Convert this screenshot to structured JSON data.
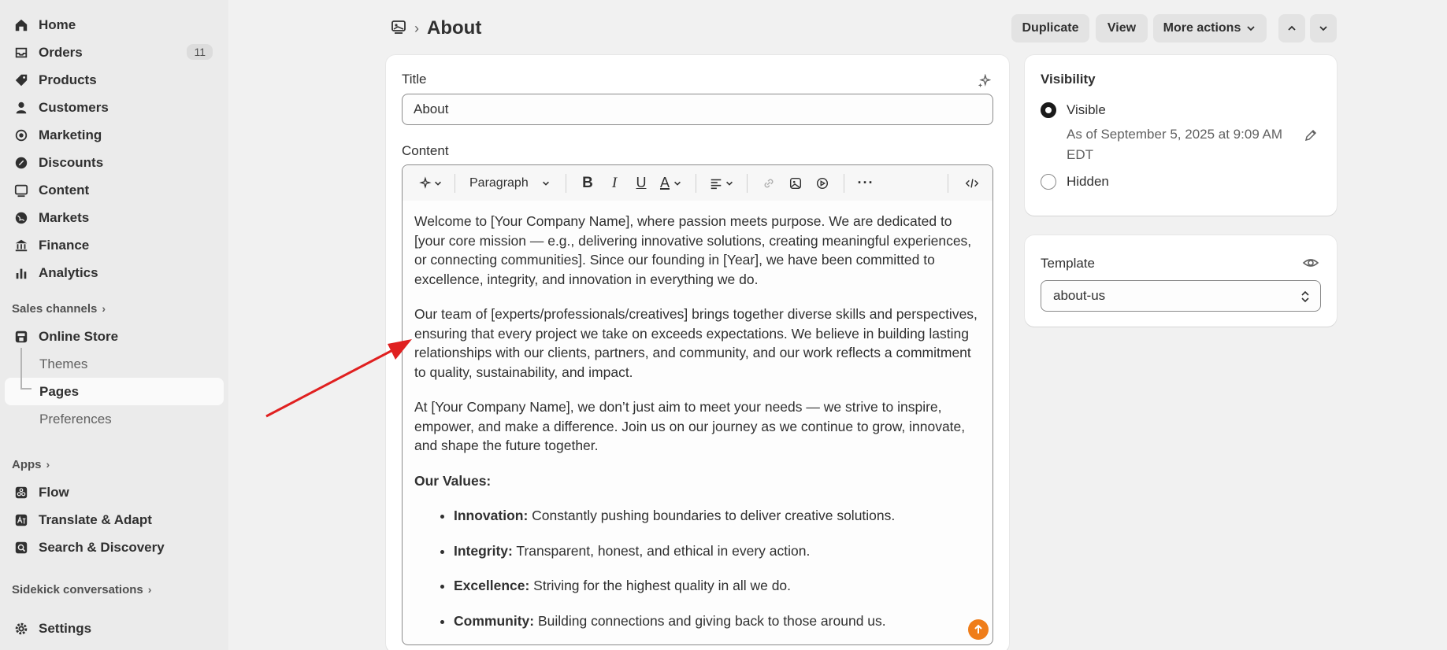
{
  "sidebar": {
    "items": [
      {
        "label": "Home",
        "icon": "home-icon"
      },
      {
        "label": "Orders",
        "icon": "orders-icon",
        "badge": "11"
      },
      {
        "label": "Products",
        "icon": "tag-icon"
      },
      {
        "label": "Customers",
        "icon": "person-icon"
      },
      {
        "label": "Marketing",
        "icon": "target-icon"
      },
      {
        "label": "Discounts",
        "icon": "discount-icon"
      },
      {
        "label": "Content",
        "icon": "content-icon"
      },
      {
        "label": "Markets",
        "icon": "globe-icon"
      },
      {
        "label": "Finance",
        "icon": "bank-icon"
      },
      {
        "label": "Analytics",
        "icon": "bar-chart-icon"
      }
    ],
    "sales_channels_label": "Sales channels",
    "online_store_label": "Online Store",
    "online_store_sub": [
      "Themes",
      "Pages",
      "Preferences"
    ],
    "apps_label": "Apps",
    "apps": [
      {
        "label": "Flow",
        "icon": "flow-icon"
      },
      {
        "label": "Translate & Adapt",
        "icon": "translate-icon"
      },
      {
        "label": "Search & Discovery",
        "icon": "search-discovery-icon"
      }
    ],
    "sidekick_label": "Sidekick conversations",
    "settings_label": "Settings"
  },
  "header": {
    "title": "About",
    "buttons": {
      "duplicate": "Duplicate",
      "view": "View",
      "more_actions": "More actions"
    }
  },
  "title_card": {
    "title_label": "Title",
    "title_value": "About",
    "content_label": "Content",
    "toolbar": {
      "format": "Paragraph"
    },
    "body": {
      "p1": "Welcome to [Your Company Name], where passion meets purpose. We are dedicated to [your core mission — e.g., delivering innovative solutions, creating meaningful experiences, or connecting communities]. Since our founding in [Year], we have been committed to excellence, integrity, and innovation in everything we do.",
      "p2": "Our team of [experts/professionals/creatives] brings together diverse skills and perspectives, ensuring that every project we take on exceeds expectations. We believe in building lasting relationships with our clients, partners, and community, and our work reflects a commitment to quality, sustainability, and impact.",
      "p3": "At [Your Company Name], we don’t just aim to meet your needs — we strive to inspire, empower, and make a difference. Join us on our journey as we continue to grow, innovate, and shape the future together.",
      "values_heading": "Our Values:",
      "values": [
        {
          "term": "Innovation:",
          "desc": " Constantly pushing boundaries to deliver creative solutions."
        },
        {
          "term": "Integrity:",
          "desc": " Transparent, honest, and ethical in every action."
        },
        {
          "term": "Excellence:",
          "desc": " Striving for the highest quality in all we do."
        },
        {
          "term": "Community:",
          "desc": " Building connections and giving back to those around us."
        }
      ]
    }
  },
  "visibility_card": {
    "heading": "Visibility",
    "visible_label": "Visible",
    "visible_line1": "As of September 5, 2025 at 9:09 AM",
    "visible_line2": "EDT",
    "hidden_label": "Hidden",
    "selected": "Visible"
  },
  "template_card": {
    "heading": "Template",
    "value": "about-us"
  },
  "colors": {
    "sidebar_bg": "#ebebeb",
    "page_bg": "#f1f1f1",
    "annotation_arrow": "#e02020",
    "fab": "#ef7d1a"
  }
}
